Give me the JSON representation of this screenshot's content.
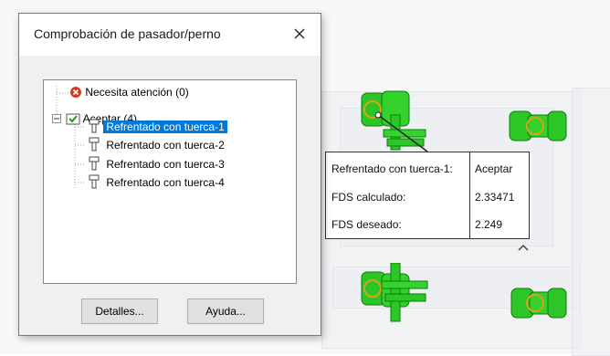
{
  "dialog": {
    "title": "Comprobación de pasador/perno",
    "tree": {
      "attention": "Necesita atención (0)",
      "accept": "Aceptar (4)",
      "items": [
        "Refrentado con tuerca-1",
        "Refrentado con tuerca-2",
        "Refrentado con tuerca-3",
        "Refrentado con tuerca-4"
      ]
    },
    "details_button": "Detalles...",
    "help_button": "Ayuda..."
  },
  "tooltip": {
    "name": "Refrentado con tuerca-1:",
    "status": "Aceptar",
    "fds_calc_label": "FDS calculado:",
    "fds_calc_value": "2.33471",
    "fds_desired_label": "FDS deseado:",
    "fds_desired_value": "2.249"
  },
  "icons": {
    "close": "close-icon",
    "error": "error-icon",
    "folder": "folder-check-icon",
    "bolt": "bolt-icon",
    "collapse": "chevron-up-icon"
  },
  "colors": {
    "selection": "#0078d7",
    "bolt_green": "#22c21a",
    "error_red": "#d9381e"
  }
}
